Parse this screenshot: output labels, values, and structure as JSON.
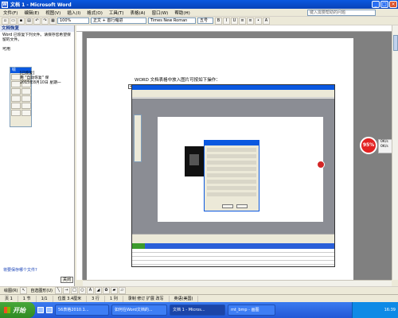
{
  "window": {
    "title": "文档 1 - Microsoft Word",
    "icon": "W"
  },
  "menu": {
    "items": [
      "文件(F)",
      "编辑(E)",
      "视图(V)",
      "插入(I)",
      "格式(O)",
      "工具(T)",
      "表格(A)",
      "窗口(W)",
      "帮助(H)"
    ],
    "help_placeholder": "键入需要帮助的问题"
  },
  "toolbar": {
    "style": "正文 + 首行缩进",
    "font": "Times New Roman",
    "size": "五号",
    "zoom": "100%"
  },
  "taskpane": {
    "title": "文档恢复",
    "text": "Word 已恢复下列文件。请保存您希望保留的文件。",
    "available": "可用",
    "toolbar_title": "绘",
    "item_tag": "[已恢复]",
    "item_line1": "用 \"自动恢复\" 保",
    "item_line2": "2015年8月10日 星期一",
    "bottom_link": "将要保存哪个文件?",
    "close_label": "关闭"
  },
  "document": {
    "text": "WORD 文档表格中放入图片可按如下操作："
  },
  "speed": {
    "percent": "95%",
    "up": "0K/s",
    "down": "0K/s"
  },
  "drawbar": {
    "draw": "绘图(R)",
    "autoshapes": "自选图形(U)"
  },
  "status": {
    "page": "页 1",
    "section": "1 节",
    "pages": "1/1",
    "position": "位置 3.4厘米",
    "line": "3 行",
    "col": "1 列",
    "flags": "录制  修订  扩展  改写",
    "language": "英语(美国)"
  },
  "taskbar": {
    "start": "开始",
    "items": [
      "56表格2010.1...",
      "如何在Word文档的...",
      "文档 1 - Micros...",
      "mt_bmp - 画图"
    ],
    "time": "16:39"
  }
}
